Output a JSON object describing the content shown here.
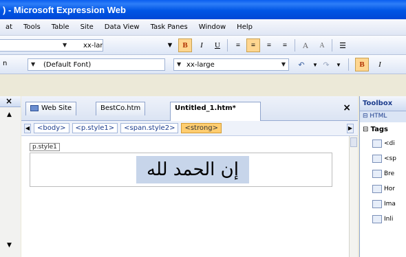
{
  "window": {
    "title": ") - Microsoft Expression Web"
  },
  "menubar": {
    "items": [
      "at",
      "Tools",
      "Table",
      "Site",
      "Data View",
      "Task Panes",
      "Window",
      "Help"
    ]
  },
  "toolbar1": {
    "font_size_value": "xx-large",
    "buttons": {
      "bold": "B",
      "italic": "I",
      "underline": "U",
      "grow_font": "A",
      "shrink_font": "A"
    }
  },
  "toolbar2": {
    "left_fragment": "n",
    "font_value": "(Default Font)",
    "size_value": "xx-large",
    "bold": "B",
    "italic": "I"
  },
  "editor": {
    "tabs": [
      "Web Site",
      "BestCo.htm",
      "Untitled_1.htm*"
    ],
    "close": "×",
    "breadcrumbs": [
      "<body>",
      "<p.style1>",
      "<span.style2>",
      "<strong>"
    ],
    "pstyle_label": "p.style1",
    "content_text": "إن الحمد لله"
  },
  "toolbox": {
    "title": "Toolbox",
    "section": "HTML",
    "group": "Tags",
    "items": [
      "<di",
      "<sp",
      "Bre",
      "Hor",
      "Ima",
      "Inli"
    ]
  },
  "colors": {
    "title_bar": "#0055e5",
    "active_button": "#ffd690",
    "selected_crumb": "#ffcd70",
    "selection_highlight": "#c7d5ea"
  }
}
